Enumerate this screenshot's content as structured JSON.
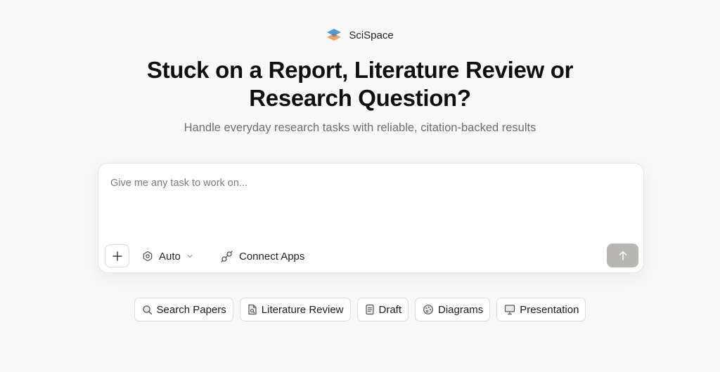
{
  "brand": {
    "name": "SciSpace",
    "logo_icon": "layers-logo-icon",
    "colors": {
      "top": "#3d8fd6",
      "bottom": "#f0a564"
    }
  },
  "hero": {
    "title_line1": "Stuck on a Report, Literature Review or",
    "title_line2": "Research Question?",
    "subtitle": "Handle everyday research tasks with reliable, citation-backed results"
  },
  "composer": {
    "placeholder": "Give me any task to work on...",
    "value": "",
    "add_icon": "plus-icon",
    "mode": {
      "label": "Auto",
      "icon": "hexagon-icon",
      "chevron": "chevron-down-icon"
    },
    "connect": {
      "label": "Connect Apps",
      "icon": "link-plug-icon"
    },
    "send": {
      "icon": "arrow-up-icon",
      "color": "#b9b7b4"
    }
  },
  "chips": [
    {
      "label": "Search Papers",
      "icon": "search-icon"
    },
    {
      "label": "Literature Review",
      "icon": "file-search-icon"
    },
    {
      "label": "Draft",
      "icon": "document-icon"
    },
    {
      "label": "Diagrams",
      "icon": "palette-icon"
    },
    {
      "label": "Presentation",
      "icon": "presentation-icon"
    }
  ]
}
